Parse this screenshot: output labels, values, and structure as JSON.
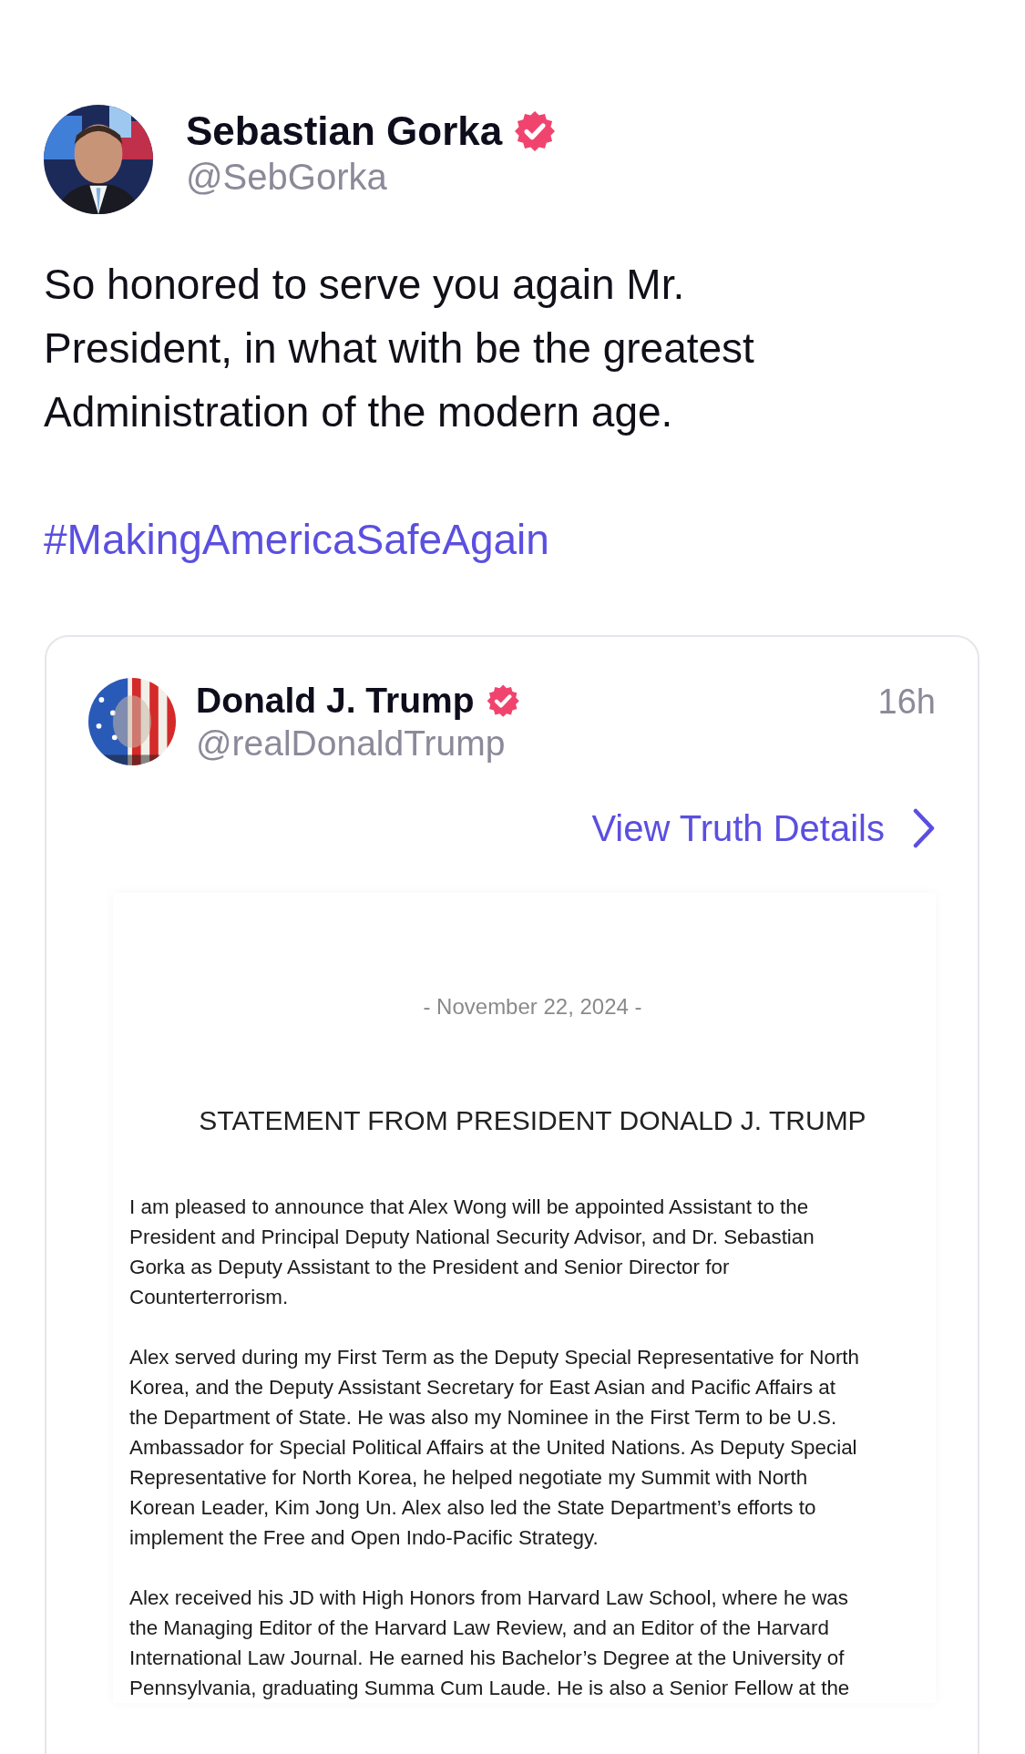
{
  "post": {
    "author": {
      "name": "Sebastian Gorka",
      "handle": "@SebGorka",
      "verified": true,
      "kind": "picture"
    },
    "text": "So honored to serve you again Mr.\nPresident, in what with be the greatest\nAdministration of the modern age.",
    "hashtag": "#MakingAmericaSafeAgain"
  },
  "quote": {
    "author": {
      "name": "Donald J. Trump",
      "handle": "@realDonaldTrump",
      "verified": true,
      "kind": "picture"
    },
    "time": "16h",
    "link": "View Truth Details",
    "document": {
      "date": "- November 22, 2024 -",
      "title": "STATEMENT FROM PRESIDENT DONALD J. TRUMP",
      "paragraphs": [
        "I am pleased to announce that Alex Wong will be appointed Assistant to the\nPresident and Principal Deputy National Security Advisor, and Dr. Sebastian\nGorka as Deputy Assistant to the President and Senior Director for\nCounterterrorism.",
        "Alex served during my First Term as the Deputy Special Representative for North\nKorea, and the Deputy Assistant Secretary for East Asian and Pacific Affairs at\nthe Department of State. He was also my Nominee in the First Term to be U.S.\nAmbassador for Special Political Affairs at the United Nations. As Deputy Special\nRepresentative for North Korea, he helped negotiate my Summit with North\nKorean Leader, Kim Jong Un. Alex also led the State Department’s efforts to\nimplement the Free and Open Indo-Pacific Strategy.",
        "Alex received his JD with High Honors from Harvard Law School, where he was\nthe Managing Editor of the Harvard Law Review, and an Editor of the Harvard\nInternational Law Journal. He earned his Bachelor’s Degree at the University of\nPennsylvania, graduating Summa Cum Laude. He is also a Senior Fellow at the"
      ]
    }
  }
}
